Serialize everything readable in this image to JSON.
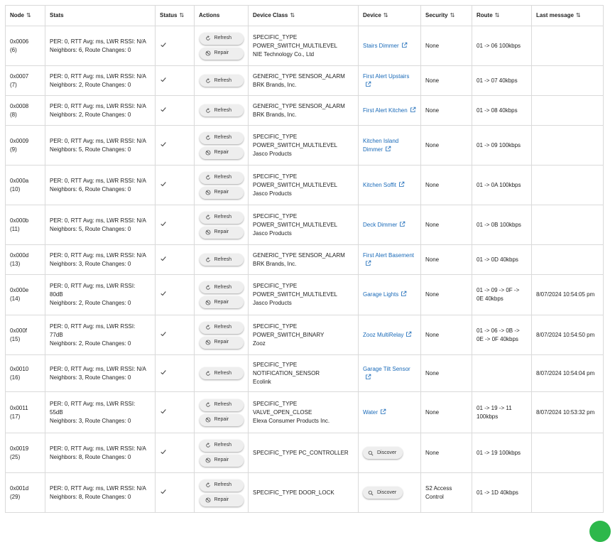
{
  "columns": [
    {
      "label": "Node",
      "sortable": true
    },
    {
      "label": "Stats",
      "sortable": false
    },
    {
      "label": "Status",
      "sortable": true
    },
    {
      "label": "Actions",
      "sortable": false
    },
    {
      "label": "Device Class",
      "sortable": true
    },
    {
      "label": "Device",
      "sortable": true
    },
    {
      "label": "Security",
      "sortable": true
    },
    {
      "label": "Route",
      "sortable": true
    },
    {
      "label": "Last message",
      "sortable": true
    }
  ],
  "sort_icon": "⇅",
  "labels": {
    "refresh": "Refresh",
    "repair": "Repair",
    "discover": "Discover"
  },
  "colors": {
    "link": "#1a6ab8",
    "button_bg": "#eeeeee",
    "border": "#dadada",
    "fab": "#2db84b"
  },
  "icons": {
    "status": "check-icon",
    "refresh": "refresh-icon",
    "repair": "repair-icon",
    "discover": "search-icon",
    "external": "external-link-icon"
  },
  "rows": [
    {
      "node": "0x0006\n(6)",
      "stats": "PER: 0, RTT Avg: ms, LWR RSSI: N/A\nNeighbors: 6, Route Changes: 0",
      "actions": [
        "refresh",
        "repair"
      ],
      "device_class": "SPECIFIC_TYPE\nPOWER_SWITCH_MULTILEVEL\nNIE Technology Co., Ltd",
      "device": "Stairs Dimmer",
      "security": "None",
      "route": "01 -> 06 100kbps",
      "last_message": ""
    },
    {
      "node": "0x0007\n(7)",
      "stats": "PER: 0, RTT Avg: ms, LWR RSSI: N/A\nNeighbors: 2, Route Changes: 0",
      "actions": [
        "refresh"
      ],
      "device_class": "GENERIC_TYPE SENSOR_ALARM\nBRK Brands, Inc.",
      "device": "First Alert Upstairs",
      "security": "None",
      "route": "01 -> 07 40kbps",
      "last_message": ""
    },
    {
      "node": "0x0008\n(8)",
      "stats": "PER: 0, RTT Avg: ms, LWR RSSI: N/A\nNeighbors: 2, Route Changes: 0",
      "actions": [
        "refresh"
      ],
      "device_class": "GENERIC_TYPE SENSOR_ALARM\nBRK Brands, Inc.",
      "device": "First Alert Kitchen",
      "security": "None",
      "route": "01 -> 08 40kbps",
      "last_message": ""
    },
    {
      "node": "0x0009\n(9)",
      "stats": "PER: 0, RTT Avg: ms, LWR RSSI: N/A\nNeighbors: 5, Route Changes: 0",
      "actions": [
        "refresh",
        "repair"
      ],
      "device_class": "SPECIFIC_TYPE\nPOWER_SWITCH_MULTILEVEL\nJasco Products",
      "device": "Kitchen Island Dimmer",
      "security": "None",
      "route": "01 -> 09 100kbps",
      "last_message": ""
    },
    {
      "node": "0x000a\n(10)",
      "stats": "PER: 0, RTT Avg: ms, LWR RSSI: N/A\nNeighbors: 6, Route Changes: 0",
      "actions": [
        "refresh",
        "repair"
      ],
      "device_class": "SPECIFIC_TYPE\nPOWER_SWITCH_MULTILEVEL\nJasco Products",
      "device": "Kitchen Soffit",
      "security": "None",
      "route": "01 -> 0A 100kbps",
      "last_message": ""
    },
    {
      "node": "0x000b\n(11)",
      "stats": "PER: 0, RTT Avg: ms, LWR RSSI: N/A\nNeighbors: 5, Route Changes: 0",
      "actions": [
        "refresh",
        "repair"
      ],
      "device_class": "SPECIFIC_TYPE\nPOWER_SWITCH_MULTILEVEL\nJasco Products",
      "device": "Deck Dimmer",
      "security": "None",
      "route": "01 -> 0B 100kbps",
      "last_message": ""
    },
    {
      "node": "0x000d\n(13)",
      "stats": "PER: 0, RTT Avg: ms, LWR RSSI: N/A\nNeighbors: 3, Route Changes: 0",
      "actions": [
        "refresh"
      ],
      "device_class": "GENERIC_TYPE SENSOR_ALARM\nBRK Brands, Inc.",
      "device": "First Alert Basement",
      "security": "None",
      "route": "01 -> 0D 40kbps",
      "last_message": ""
    },
    {
      "node": "0x000e\n(14)",
      "stats": "PER: 0, RTT Avg: ms, LWR RSSI:\n80dB\nNeighbors: 2, Route Changes: 0",
      "actions": [
        "refresh",
        "repair"
      ],
      "device_class": "SPECIFIC_TYPE\nPOWER_SWITCH_MULTILEVEL\nJasco Products",
      "device": "Garage Lights",
      "security": "None",
      "route": "01 -> 09 -> 0F ->\n0E 40kbps",
      "last_message": "8/07/2024 10:54:05 pm"
    },
    {
      "node": "0x000f\n(15)",
      "stats": "PER: 0, RTT Avg: ms, LWR RSSI:\n77dB\nNeighbors: 2, Route Changes: 0",
      "actions": [
        "refresh",
        "repair"
      ],
      "device_class": "SPECIFIC_TYPE\nPOWER_SWITCH_BINARY\nZooz",
      "device": "Zooz MultiRelay",
      "security": "None",
      "route": "01 -> 06 -> 0B ->\n0E -> 0F 40kbps",
      "last_message": "8/07/2024 10:54:50 pm"
    },
    {
      "node": "0x0010\n(16)",
      "stats": "PER: 0, RTT Avg: ms, LWR RSSI: N/A\nNeighbors: 3, Route Changes: 0",
      "actions": [
        "refresh"
      ],
      "device_class": "SPECIFIC_TYPE\nNOTIFICATION_SENSOR\nEcolink",
      "device": "Garage Tilt Sensor",
      "security": "None",
      "route": "",
      "last_message": "8/07/2024 10:54:04 pm"
    },
    {
      "node": "0x0011\n(17)",
      "stats": "PER: 0, RTT Avg: ms, LWR RSSI:\n55dB\nNeighbors: 3, Route Changes: 0",
      "actions": [
        "refresh",
        "repair"
      ],
      "device_class": "SPECIFIC_TYPE\nVALVE_OPEN_CLOSE\nElexa Consumer Products Inc.",
      "device": "Water",
      "security": "None",
      "route": "01 -> 19 -> 11\n100kbps",
      "last_message": "8/07/2024 10:53:32 pm"
    },
    {
      "node": "0x0019\n(25)",
      "stats": "PER: 0, RTT Avg: ms, LWR RSSI: N/A\nNeighbors: 8, Route Changes: 0",
      "actions": [
        "refresh",
        "repair"
      ],
      "device_class": "SPECIFIC_TYPE PC_CONTROLLER",
      "device": "",
      "discover": true,
      "security": "None",
      "route": "01 -> 19 100kbps",
      "last_message": ""
    },
    {
      "node": "0x001d\n(29)",
      "stats": "PER: 0, RTT Avg: ms, LWR RSSI: N/A\nNeighbors: 8, Route Changes: 0",
      "actions": [
        "refresh",
        "repair"
      ],
      "device_class": "SPECIFIC_TYPE DOOR_LOCK",
      "device": "",
      "discover": true,
      "security": "S2 Access\nControl",
      "route": "01 -> 1D 40kbps",
      "last_message": ""
    }
  ]
}
